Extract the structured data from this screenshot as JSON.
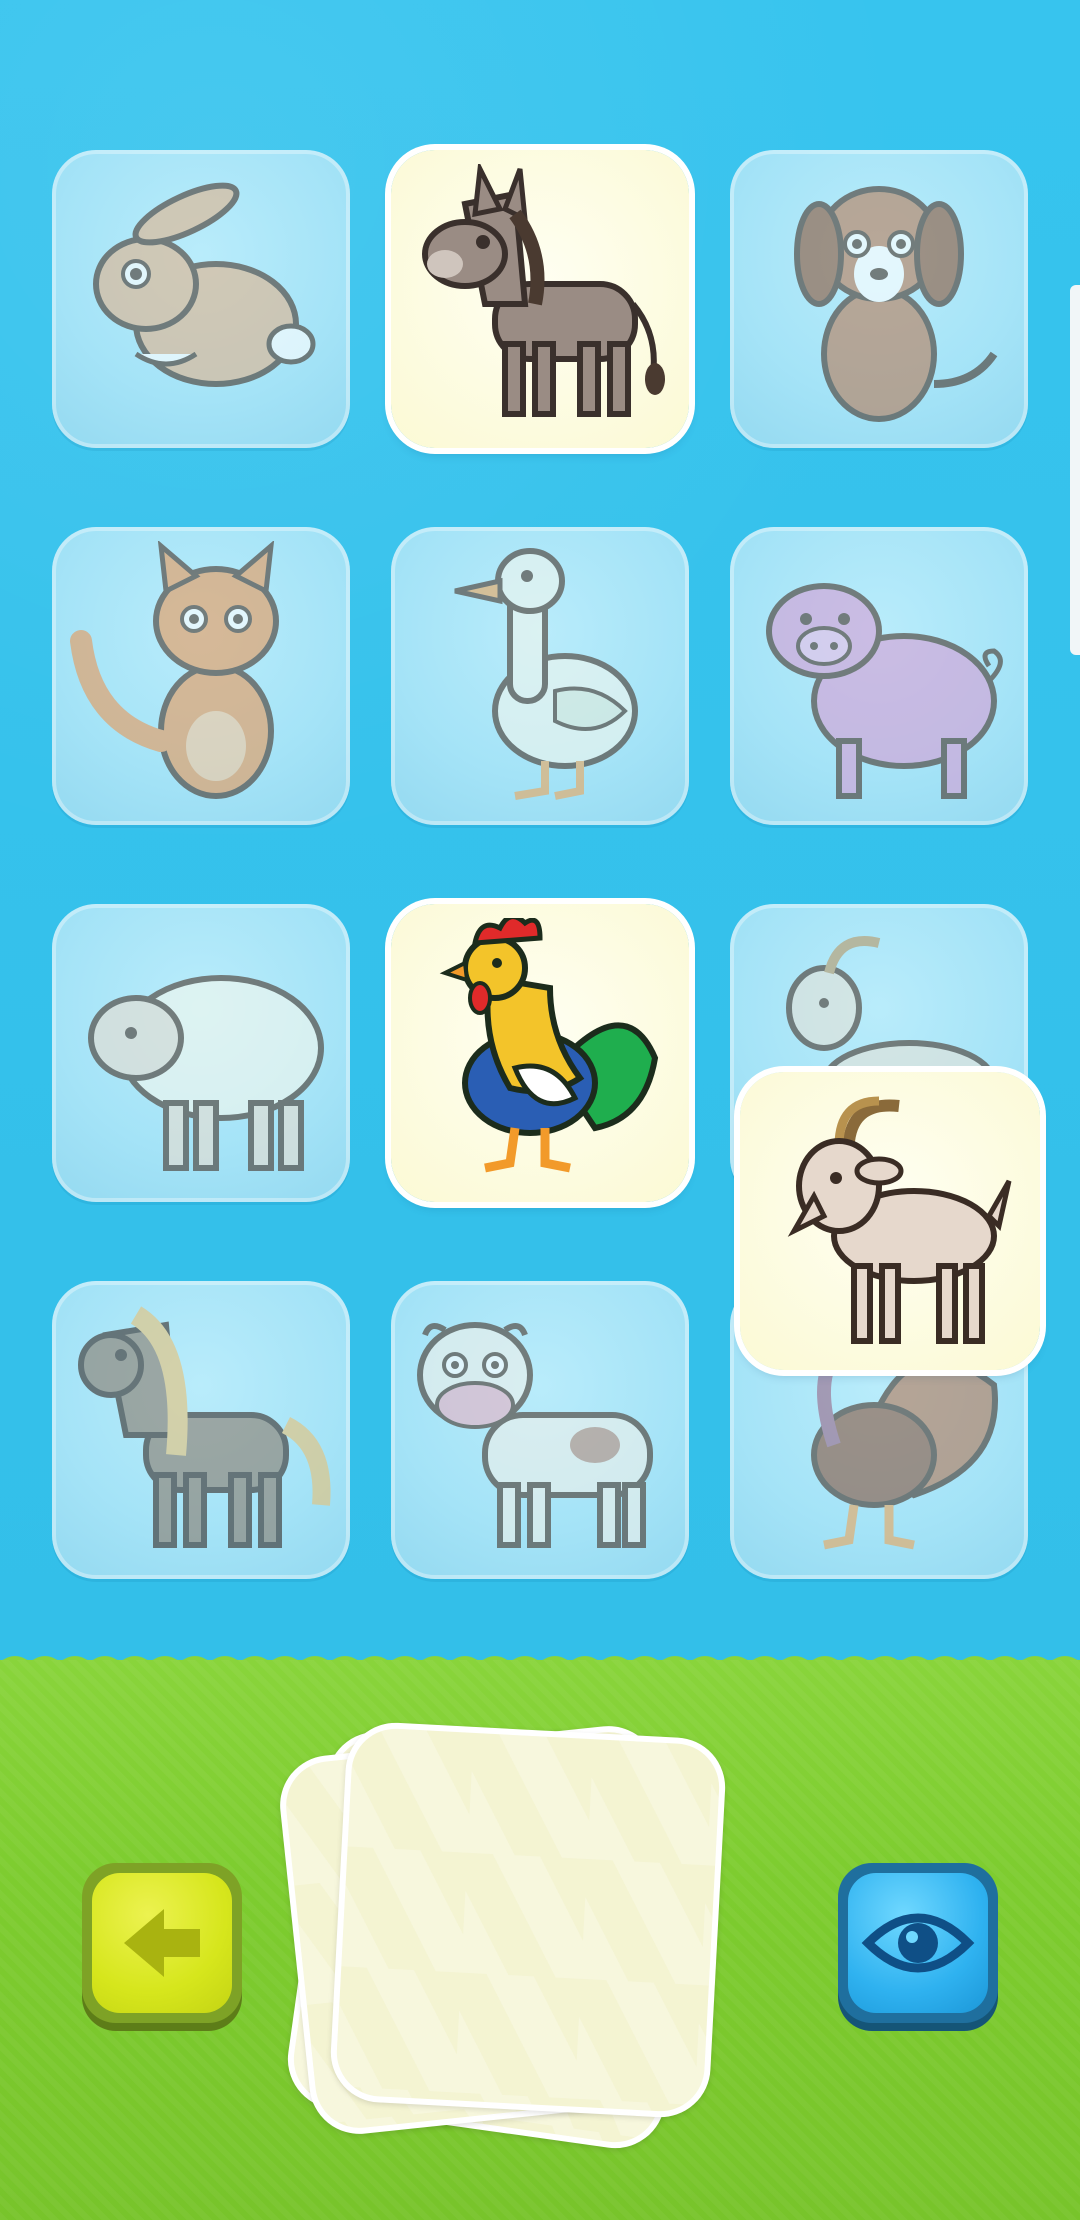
{
  "game": {
    "theme": "farm-animals-memory",
    "grid_rows": 4,
    "grid_cols": 3
  },
  "tiles": [
    {
      "animal": "rabbit",
      "state": "hidden"
    },
    {
      "animal": "donkey",
      "state": "revealed"
    },
    {
      "animal": "dog",
      "state": "hidden"
    },
    {
      "animal": "cat",
      "state": "hidden"
    },
    {
      "animal": "goose",
      "state": "hidden"
    },
    {
      "animal": "pig",
      "state": "hidden"
    },
    {
      "animal": "sheep",
      "state": "hidden"
    },
    {
      "animal": "rooster",
      "state": "revealed"
    },
    {
      "animal": "goat",
      "state": "hidden"
    },
    {
      "animal": "horse",
      "state": "hidden"
    },
    {
      "animal": "cow",
      "state": "hidden"
    },
    {
      "animal": "turkey",
      "state": "hidden"
    }
  ],
  "dragged_tile": {
    "animal": "goat",
    "state": "revealed"
  },
  "controls": {
    "back_icon": "arrow-left-icon",
    "reveal_icon": "eye-icon"
  },
  "deck": {
    "visible_cards": 3
  },
  "colors": {
    "sky": "#35c3ec",
    "grass": "#7dcc2f",
    "tile_hidden": "#a4e3f7",
    "tile_revealed": "#fbf9d4",
    "back_button": "#d6e61c",
    "eye_button": "#2fb2f0"
  }
}
